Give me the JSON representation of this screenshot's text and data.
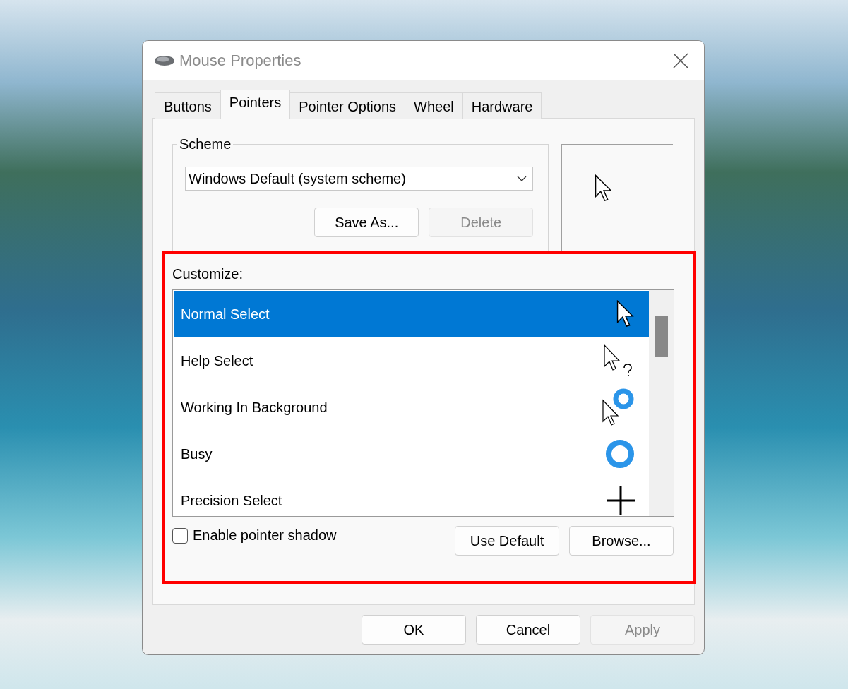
{
  "window": {
    "title": "Mouse Properties"
  },
  "tabs": [
    {
      "label": "Buttons",
      "selected": false
    },
    {
      "label": "Pointers",
      "selected": true
    },
    {
      "label": "Pointer Options",
      "selected": false
    },
    {
      "label": "Wheel",
      "selected": false
    },
    {
      "label": "Hardware",
      "selected": false
    }
  ],
  "scheme": {
    "label": "Scheme",
    "value": "Windows Default (system scheme)",
    "buttons": [
      {
        "label": "Save As...",
        "disabled": false
      },
      {
        "label": "Delete",
        "disabled": true
      }
    ]
  },
  "customize": {
    "label": "Customize:",
    "items": [
      {
        "name": "Normal Select",
        "kind": "arrow",
        "selected": true
      },
      {
        "name": "Help Select",
        "kind": "help",
        "selected": false
      },
      {
        "name": "Working In Background",
        "kind": "working",
        "selected": false
      },
      {
        "name": "Busy",
        "kind": "busy",
        "selected": false
      },
      {
        "name": "Precision Select",
        "kind": "cross",
        "selected": false
      }
    ]
  },
  "shadow": {
    "label": "Enable pointer shadow",
    "checked": false
  },
  "list_buttons": [
    {
      "label": "Use Default",
      "disabled": false
    },
    {
      "label": "Browse...",
      "disabled": false
    }
  ],
  "footer_buttons": [
    {
      "label": "OK",
      "disabled": false
    },
    {
      "label": "Cancel",
      "disabled": false
    },
    {
      "label": "Apply",
      "disabled": true
    }
  ]
}
